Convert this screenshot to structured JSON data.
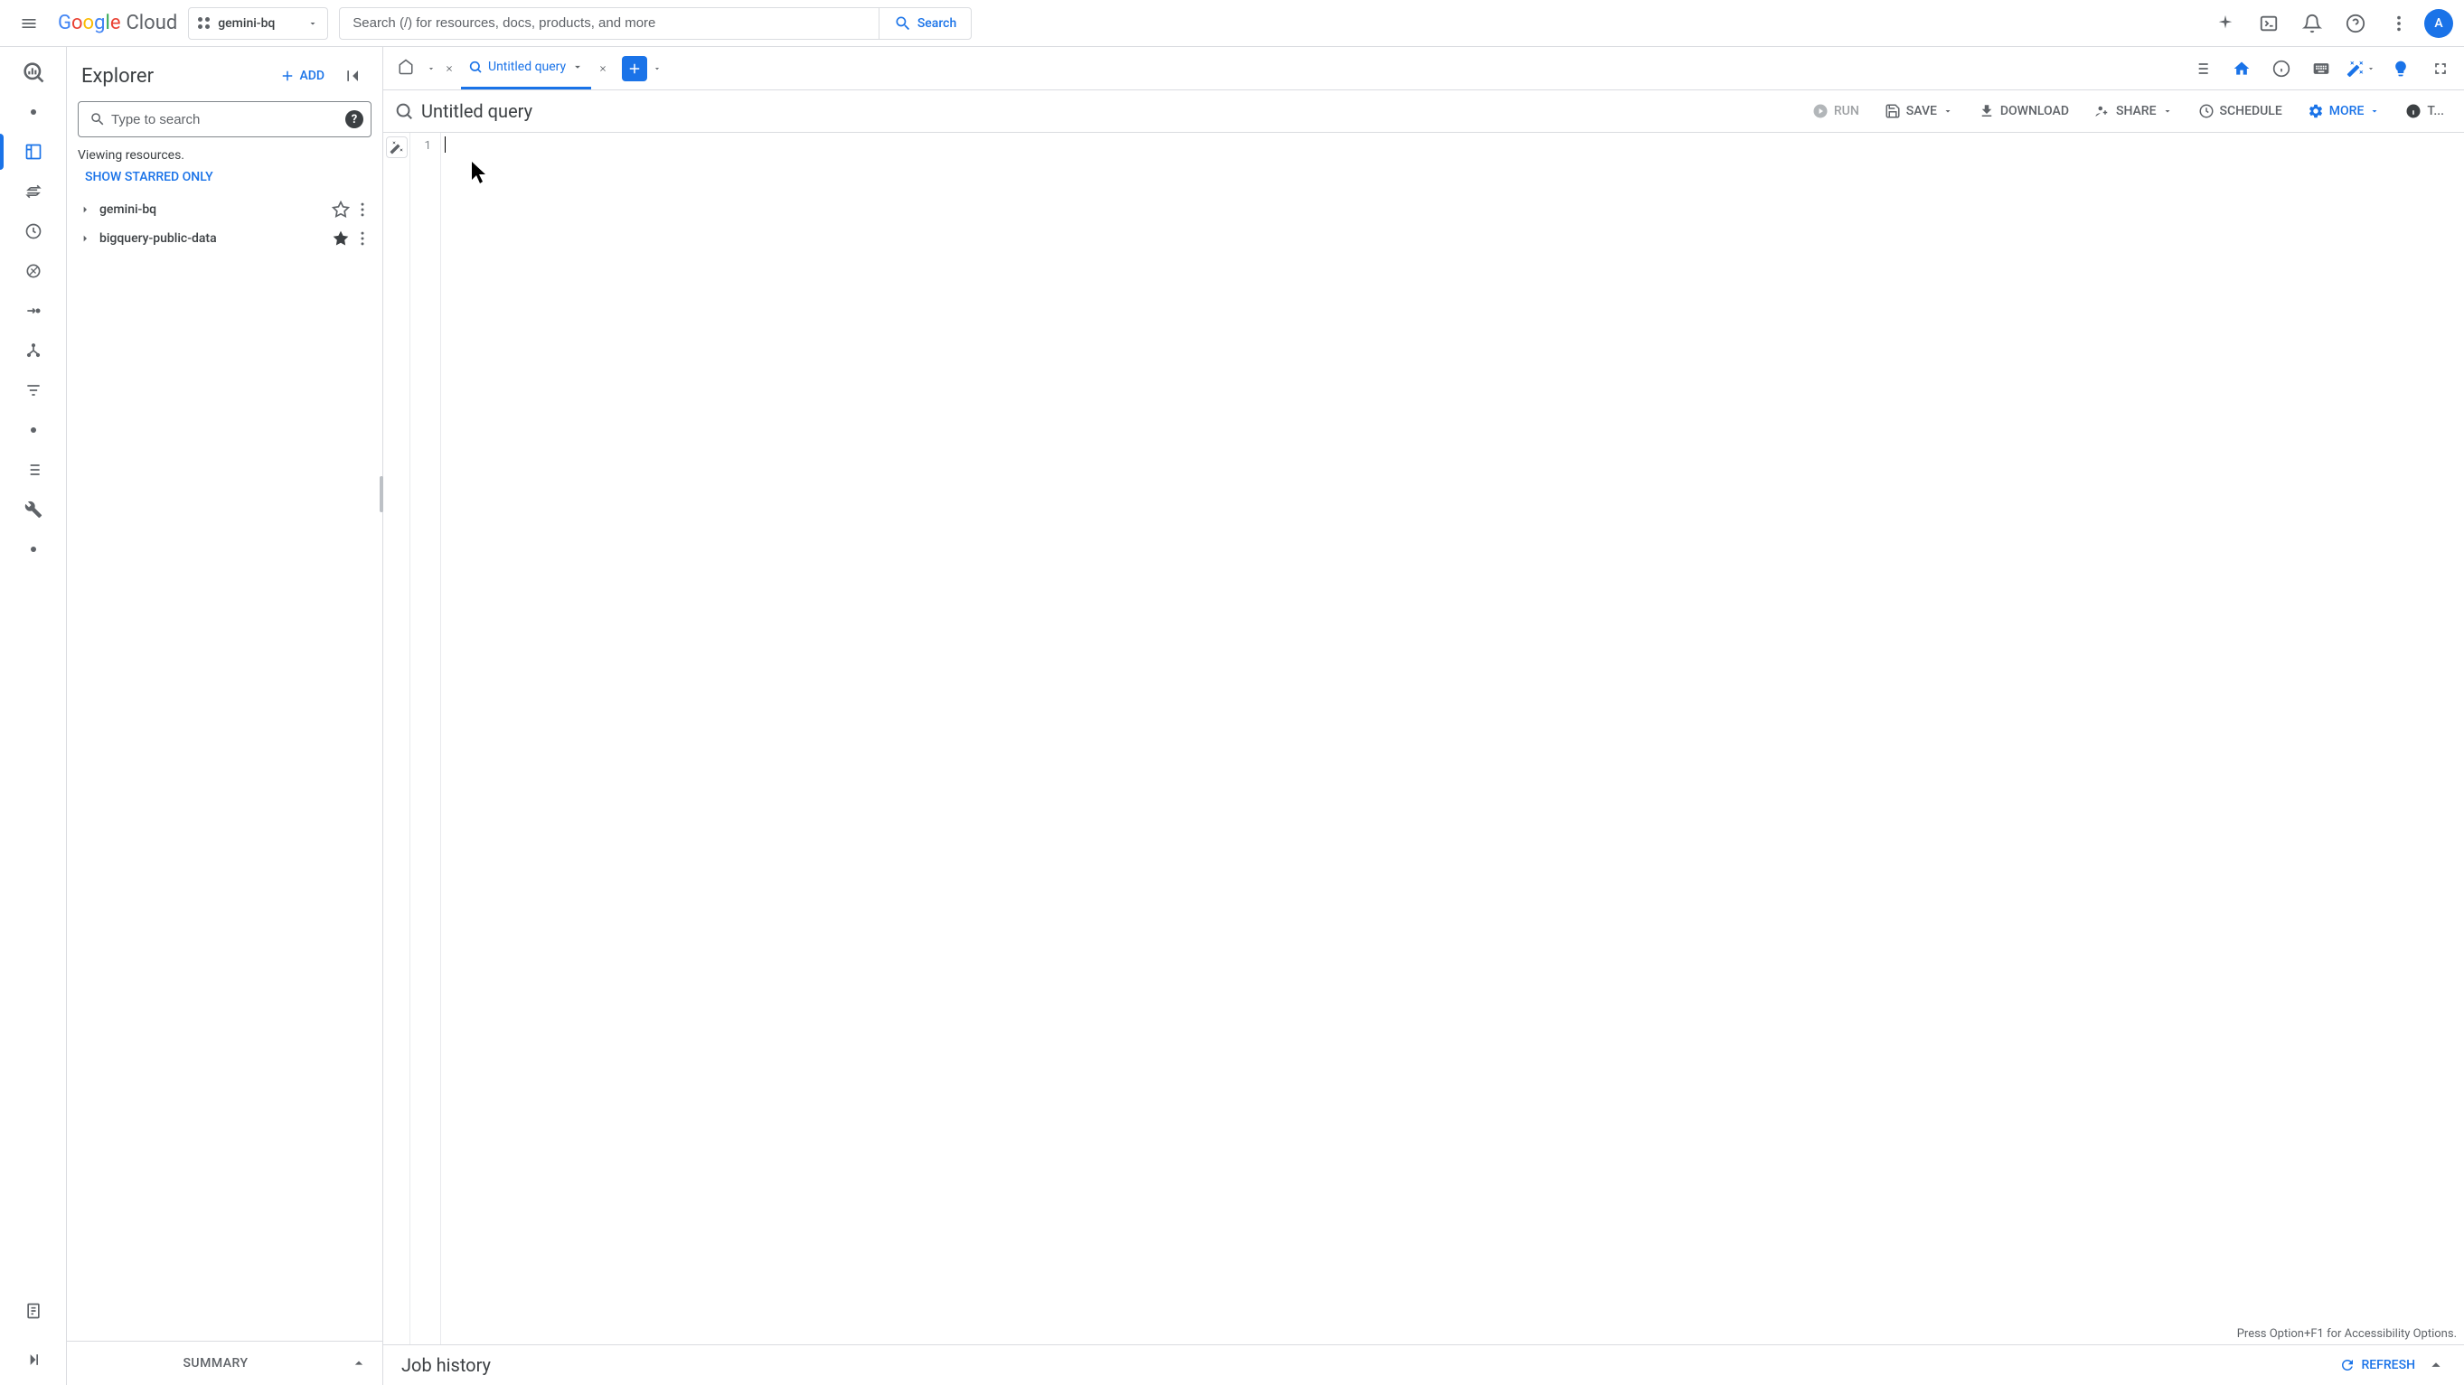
{
  "header": {
    "logo_cloud_text": "Cloud",
    "project_name": "gemini-bq",
    "search_placeholder": "Search (/) for resources, docs, products, and more",
    "search_button": "Search",
    "avatar_initial": "A"
  },
  "explorer": {
    "title": "Explorer",
    "add_button": "ADD",
    "search_placeholder": "Type to search",
    "viewing_text": "Viewing resources.",
    "starred_link": "SHOW STARRED ONLY",
    "items": [
      {
        "label": "gemini-bq",
        "starred": false
      },
      {
        "label": "bigquery-public-data",
        "starred": true
      }
    ],
    "summary_label": "SUMMARY"
  },
  "tabs": {
    "active_tab_label": "Untitled query"
  },
  "query_toolbar": {
    "title": "Untitled query",
    "run": "RUN",
    "save": "SAVE",
    "download": "DOWNLOAD",
    "share": "SHARE",
    "schedule": "SCHEDULE",
    "more": "MORE",
    "truncated": "T..."
  },
  "editor": {
    "line_number": "1",
    "accessibility_hint": "Press Option+F1 for Accessibility Options."
  },
  "job_history": {
    "title": "Job history",
    "refresh": "REFRESH"
  }
}
